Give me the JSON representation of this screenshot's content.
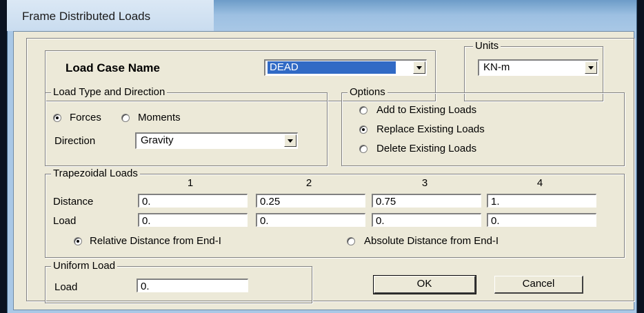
{
  "window": {
    "title": "Frame Distributed Loads"
  },
  "load_case": {
    "label": "Load Case Name",
    "value": "DEAD"
  },
  "units": {
    "legend": "Units",
    "value": "KN-m"
  },
  "load_type": {
    "legend": "Load Type and Direction",
    "forces_label": "Forces",
    "moments_label": "Moments",
    "direction_label": "Direction",
    "direction_value": "Gravity"
  },
  "options": {
    "legend": "Options",
    "add_label": "Add to Existing Loads",
    "replace_label": "Replace Existing Loads",
    "delete_label": "Delete Existing Loads"
  },
  "trapezoidal": {
    "legend": "Trapezoidal Loads",
    "columns": [
      "1",
      "2",
      "3",
      "4"
    ],
    "distance_label": "Distance",
    "load_label": "Load",
    "distances": [
      "0.",
      "0.25",
      "0.75",
      "1."
    ],
    "loads": [
      "0.",
      "0.",
      "0.",
      "0."
    ],
    "relative_label": "Relative Distance from End-I",
    "absolute_label": "Absolute Distance from End-I"
  },
  "uniform": {
    "legend": "Uniform Load",
    "load_label": "Load",
    "load_value": "0."
  },
  "buttons": {
    "ok": "OK",
    "cancel": "Cancel"
  }
}
